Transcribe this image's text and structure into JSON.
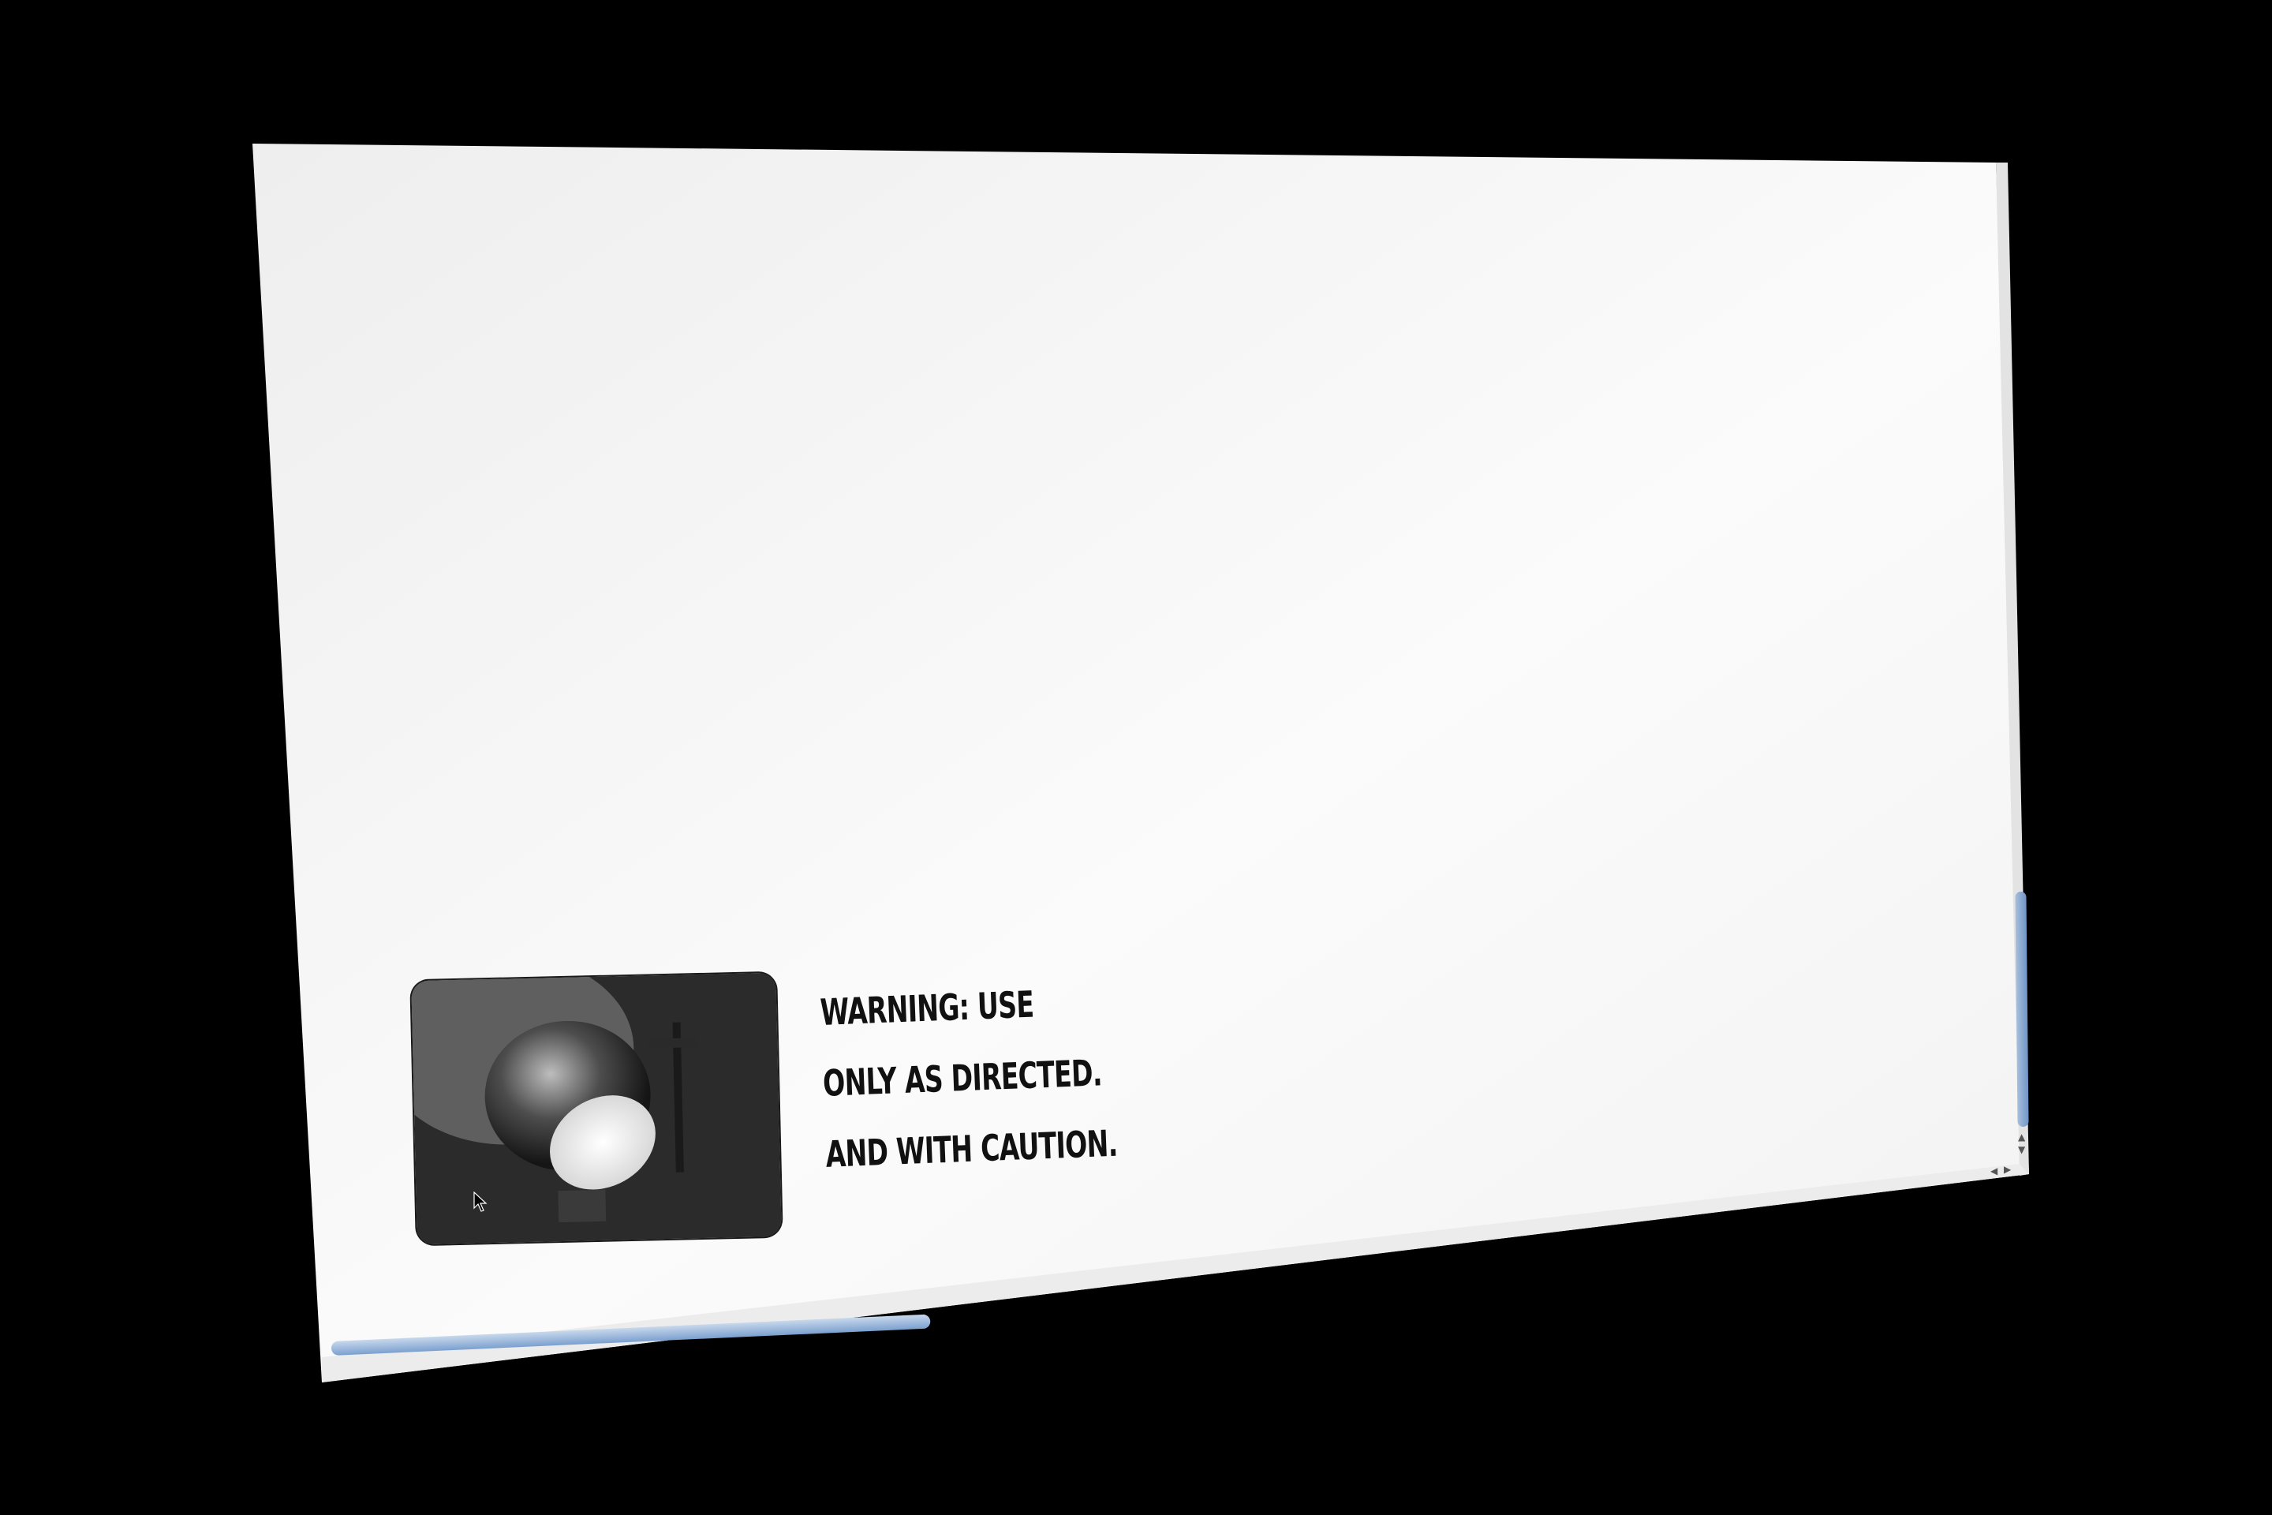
{
  "page": {
    "background_color": "#000000",
    "screen_color": "#f7f7f7"
  },
  "content": {
    "thumbnail_icon": "spotlight-photo",
    "warning_lines": [
      "WARNING: USE",
      "ONLY AS DIRECTED.",
      "AND WITH CAUTION."
    ]
  },
  "scrollbars": {
    "accent_color": "#7ba0cf",
    "arrow_up": "▲",
    "arrow_down": "▼",
    "arrow_left": "◀",
    "arrow_right": "▶"
  }
}
